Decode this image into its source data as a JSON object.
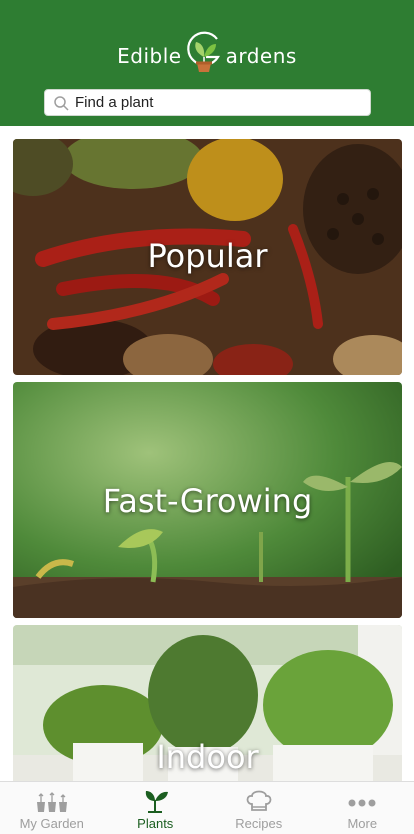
{
  "app": {
    "brand_left": "Edible",
    "brand_right": "ardens",
    "logo": "g-sprout-logo-icon",
    "colors": {
      "header": "#2e7d32",
      "active_tab": "#1b5e20",
      "inactive_tab": "#9e9e9e"
    }
  },
  "search": {
    "placeholder": "Find a plant",
    "icon": "search-icon"
  },
  "categories": [
    {
      "label": "Popular"
    },
    {
      "label": "Fast-Growing"
    },
    {
      "label": "Indoor"
    }
  ],
  "tabbar": {
    "items": [
      {
        "label": "My Garden",
        "icon": "plant-pots-icon",
        "active": false
      },
      {
        "label": "Plants",
        "icon": "sprout-icon",
        "active": true
      },
      {
        "label": "Recipes",
        "icon": "chef-hat-icon",
        "active": false
      },
      {
        "label": "More",
        "icon": "more-dots-icon",
        "active": false
      }
    ]
  }
}
